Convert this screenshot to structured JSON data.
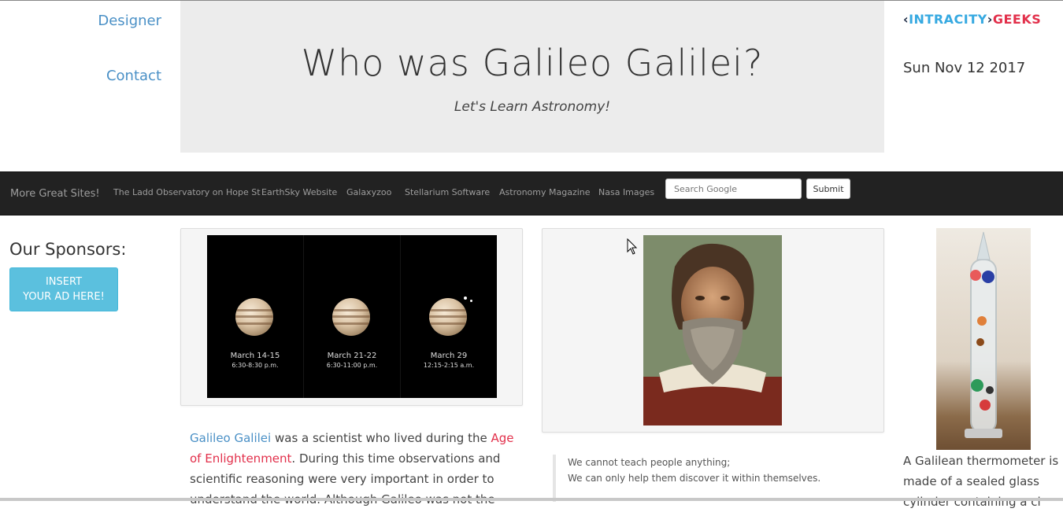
{
  "left_nav": {
    "designer_label": "Designer",
    "contact_label": "Contact"
  },
  "hero": {
    "title": "Who was Galileo Galilei?",
    "subtitle": "Let's Learn Astronomy!"
  },
  "logo": {
    "part1": "INTRACITY",
    "part2": "GEEKS",
    "colors": {
      "accent": "#36a9e1",
      "brand": "#e2304b"
    }
  },
  "date": "Sun Nov 12 2017",
  "navbar": {
    "brand": "More Great Sites!",
    "links": [
      "The Ladd Observatory on Hope St",
      "EarthSky Website",
      "Galaxyzoo",
      "Stellarium Software",
      "Astronomy Magazine",
      "Nasa Images"
    ],
    "search_placeholder": "Search Google",
    "submit_label": "Submit"
  },
  "sponsors": {
    "title": "Our Sponsors:",
    "ad_line1": "INSERT",
    "ad_line2": "YOUR AD HERE!"
  },
  "jupiter_panel": {
    "captions": [
      {
        "date": "March 14-15",
        "time": "6:30-8:30 p.m."
      },
      {
        "date": "March 21-22",
        "time": "6:30-11:00 p.m."
      },
      {
        "date": "March 29",
        "time": "12:15-2:15 a.m."
      }
    ]
  },
  "article": {
    "link1": "Galileo Galilei",
    "text1": " was a scientist who lived during the ",
    "link2": "Age of Enlightenment",
    "text2": ". During this time observations and scientific reasoning were very important in order to understand the world. Although Galileo was not the"
  },
  "quote": {
    "line1": "We cannot teach people anything;",
    "line2": "We can only help them discover it within themselves."
  },
  "thermometer_caption": "A Galilean thermometer is made of a sealed glass cylinder containing a cl"
}
